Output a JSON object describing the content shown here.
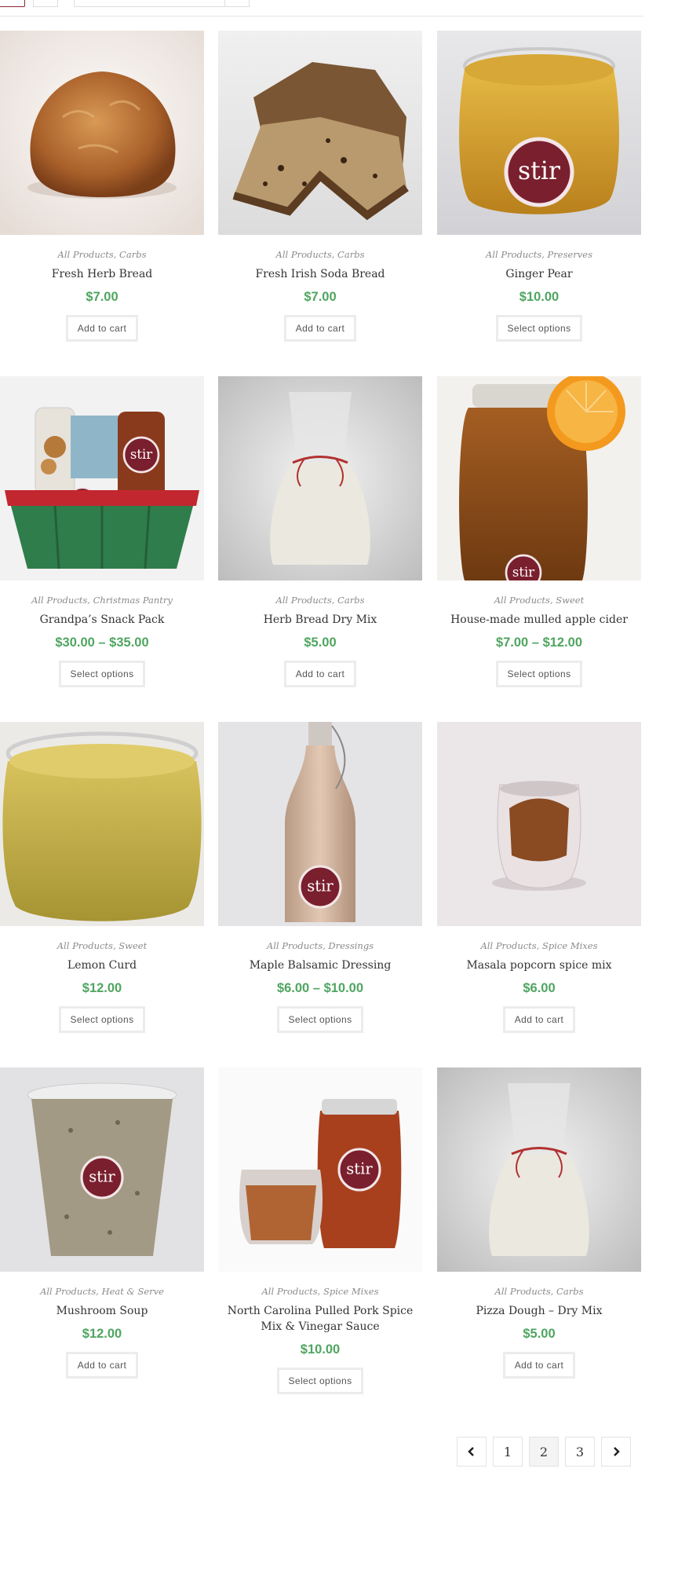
{
  "toolbar": {
    "active_view": "grid",
    "sort_select_value": ""
  },
  "products": [
    {
      "categories": "All Products, Carbs",
      "name": "Fresh Herb Bread",
      "price": "$7.00",
      "button": "Add to cart",
      "image": "herb-bread-loaf"
    },
    {
      "categories": "All Products, Carbs",
      "name": "Fresh Irish Soda Bread",
      "price": "$7.00",
      "button": "Add to cart",
      "image": "soda-bread"
    },
    {
      "categories": "All Products, Preserves",
      "name": "Ginger Pear",
      "price": "$10.00",
      "button": "Select options",
      "image": "ginger-pear-jar"
    },
    {
      "categories": "All Products, Christmas Pantry",
      "name": "Grandpa’s Snack Pack",
      "price": "$30.00 – $35.00",
      "button": "Select options",
      "image": "snack-basket"
    },
    {
      "categories": "All Products, Carbs",
      "name": "Herb Bread Dry Mix",
      "price": "$5.00",
      "button": "Add to cart",
      "image": "flour-bag"
    },
    {
      "categories": "All Products, Sweet",
      "name": "House-made mulled apple cider",
      "price": "$7.00 – $12.00",
      "button": "Select options",
      "image": "cider-jar"
    },
    {
      "categories": "All Products, Sweet",
      "name": "Lemon Curd",
      "price": "$12.00",
      "button": "Select options",
      "image": "lemon-curd-jar"
    },
    {
      "categories": "All Products, Dressings",
      "name": "Maple Balsamic Dressing",
      "price": "$6.00 – $10.00",
      "button": "Select options",
      "image": "dressing-bottle"
    },
    {
      "categories": "All Products, Spice Mixes",
      "name": "Masala popcorn spice mix",
      "price": "$6.00",
      "button": "Add to cart",
      "image": "spice-jar"
    },
    {
      "categories": "All Products, Heat & Serve",
      "name": "Mushroom Soup",
      "price": "$12.00",
      "button": "Add to cart",
      "image": "soup-cup"
    },
    {
      "categories": "All Products, Spice Mixes",
      "name": "North Carolina Pulled Pork Spice Mix & Vinegar Sauce",
      "price": "$10.00",
      "button": "Select options",
      "image": "spice-and-sauce"
    },
    {
      "categories": "All Products, Carbs",
      "name": "Pizza Dough – Dry Mix",
      "price": "$5.00",
      "button": "Add to cart",
      "image": "flour-bag"
    }
  ],
  "pagination": {
    "prev_icon": "chevron-left-icon",
    "pages": [
      "1",
      "2",
      "3"
    ],
    "current": "2",
    "next_icon": "chevron-right-icon"
  },
  "brand_label": "stir",
  "colors": {
    "price": "#4fa560",
    "brand": "#7a1f2e",
    "button_border": "#ececec"
  }
}
